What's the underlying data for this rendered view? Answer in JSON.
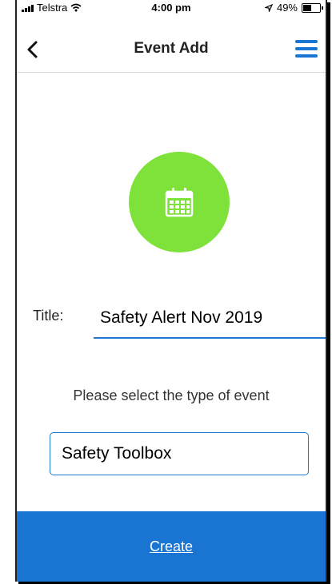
{
  "status": {
    "carrier": "Telstra",
    "time": "4:00 pm",
    "battery": "49%",
    "battery_level": 0.49
  },
  "header": {
    "title": "Event Add",
    "back_icon": "chevron-left-icon",
    "menu_icon": "hamburger-menu-icon"
  },
  "hero": {
    "icon": "calendar-icon",
    "circle_color": "#7ee23a"
  },
  "form": {
    "title_label": "Title:",
    "title_value": "Safety Alert Nov 2019",
    "type_prompt": "Please select the type of event",
    "type_value": "Safety Toolbox"
  },
  "footer": {
    "create_label": "Create",
    "color": "#1a74d2"
  },
  "colors": {
    "accent": "#1f78d1"
  }
}
